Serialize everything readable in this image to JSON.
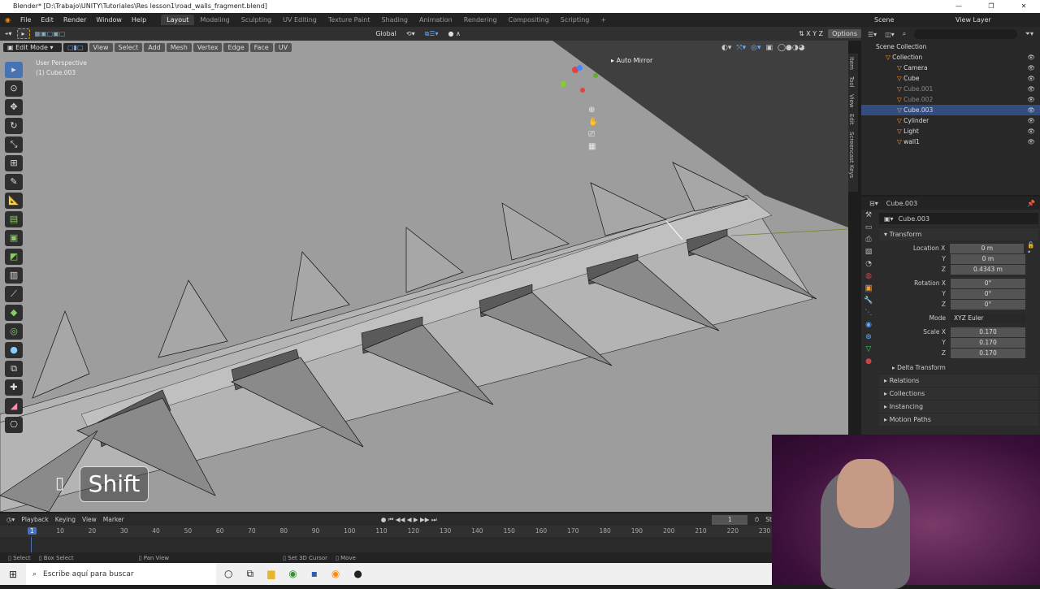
{
  "window": {
    "title": "Blender* [D:\\Trabajo\\UNITY\\Tutoriales\\Res lesson1\\road_walls_fragment.blend]",
    "controls": [
      "—",
      "❐",
      "✕"
    ]
  },
  "menu": [
    "File",
    "Edit",
    "Render",
    "Window",
    "Help"
  ],
  "workspaces": [
    "Layout",
    "Modeling",
    "Sculpting",
    "UV Editing",
    "Texture Paint",
    "Shading",
    "Animation",
    "Rendering",
    "Compositing",
    "Scripting",
    "+"
  ],
  "scene": "Scene",
  "view_layer": "View Layer",
  "tool_header": {
    "orientation": "Global",
    "options": "Options"
  },
  "viewport_header": {
    "mode": "Edit Mode",
    "menus": [
      "View",
      "Select",
      "Add",
      "Mesh",
      "Vertex",
      "Edge",
      "Face",
      "UV"
    ]
  },
  "viewport": {
    "view_name": "User Perspective",
    "object_name": "(1) Cube.003",
    "auto_mirror": "Auto Mirror",
    "key_overlay": "Shift"
  },
  "side_tabs": [
    "Item",
    "Tool",
    "View",
    "Edit",
    "Screencast Keys"
  ],
  "outliner": {
    "root": "Scene Collection",
    "items": [
      {
        "name": "Collection",
        "state": "normal"
      },
      {
        "name": "Camera",
        "state": "normal"
      },
      {
        "name": "Cube",
        "state": "normal"
      },
      {
        "name": "Cube.001",
        "state": "dim"
      },
      {
        "name": "Cube.002",
        "state": "dim"
      },
      {
        "name": "Cube.003",
        "state": "selected"
      },
      {
        "name": "Cylinder",
        "state": "normal"
      },
      {
        "name": "Light",
        "state": "normal"
      },
      {
        "name": "wall1",
        "state": "normal"
      }
    ]
  },
  "properties": {
    "object": "Cube.003",
    "object_field": "Cube.003",
    "transform": "Transform",
    "location": {
      "label": "Location X",
      "x": "0 m",
      "y": "0 m",
      "z": "0.4343 m"
    },
    "rotation": {
      "label": "Rotation X",
      "x": "0°",
      "y": "0°",
      "z": "0°"
    },
    "mode": {
      "label": "Mode",
      "value": "XYZ Euler"
    },
    "scale": {
      "label": "Scale X",
      "x": "0.170",
      "y": "0.170",
      "z": "0.170"
    },
    "axis": {
      "y": "Y",
      "z": "Z"
    },
    "sections": [
      "Delta Transform",
      "Relations",
      "Collections",
      "Instancing",
      "Motion Paths"
    ]
  },
  "timeline": {
    "menus": [
      "Playback",
      "Keying",
      "View",
      "Marker"
    ],
    "current_frame": "1",
    "start_label": "St",
    "ticks": [
      "1",
      "10",
      "20",
      "30",
      "40",
      "50",
      "60",
      "70",
      "80",
      "90",
      "100",
      "110",
      "120",
      "130",
      "140",
      "150",
      "160",
      "170",
      "180",
      "190",
      "200",
      "210",
      "220",
      "230"
    ]
  },
  "statusbar": [
    "Select",
    "Box Select",
    "Pan View",
    "Set 3D Cursor",
    "Move"
  ],
  "taskbar": {
    "search_placeholder": "Escribe aquí para buscar"
  }
}
